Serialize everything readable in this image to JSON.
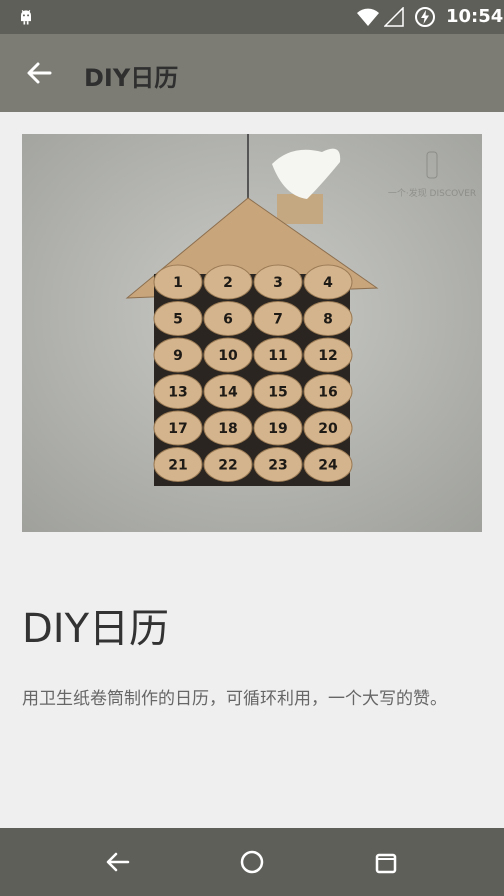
{
  "statusbar": {
    "time": "10:54",
    "icons": [
      "android-debug-icon",
      "wifi-icon",
      "signal-icon",
      "battery-charging-icon"
    ]
  },
  "appbar": {
    "title": "DIY日历",
    "back_icon": "back-arrow-icon"
  },
  "hero": {
    "image": "toilet-paper-roll-advent-calendar-photo",
    "watermark": "一个·发现 DISCOVER",
    "calendar_numbers": [
      "1",
      "2",
      "3",
      "4",
      "5",
      "6",
      "7",
      "8",
      "9",
      "10",
      "11",
      "12",
      "13",
      "14",
      "15",
      "16",
      "17",
      "18",
      "19",
      "20",
      "21",
      "22",
      "23",
      "24"
    ]
  },
  "article": {
    "title": "DIY日历",
    "description": "用卫生纸卷筒制作的日历，可循环利用，一个大写的赞。"
  },
  "navbar": {
    "icons": [
      "nav-back-icon",
      "nav-home-icon",
      "nav-recents-icon"
    ]
  }
}
